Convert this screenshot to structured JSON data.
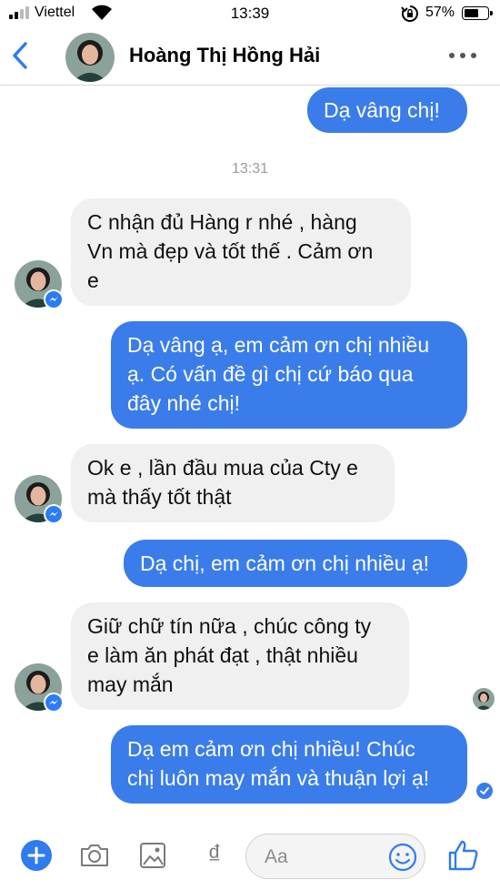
{
  "status_bar": {
    "carrier": "Viettel",
    "time": "13:39",
    "battery_percent": "57%"
  },
  "header": {
    "contact_name": "Hoàng Thị Hồng Hải"
  },
  "conversation": {
    "top_message": "Dạ vâng chị!",
    "timestamp": "13:31",
    "messages": [
      {
        "from": "contact",
        "line1": "C nhận đủ Hàng r nhé , hàng",
        "line2": "Vn mà đẹp và tốt thế . Cảm ơn",
        "line3": "e"
      },
      {
        "from": "me",
        "line1": "Dạ vâng ạ, em cảm ơn chị nhiều",
        "line2": "ạ. Có vấn đề gì chị cứ báo qua",
        "line3": "đây nhé chị!"
      },
      {
        "from": "contact",
        "line1": "Ok e , lần đầu mua của Cty e",
        "line2": "mà thấy tốt thật"
      },
      {
        "from": "me",
        "line1": "Dạ chị, em cảm ơn chị nhiều ạ!"
      },
      {
        "from": "contact",
        "line1": "Giữ chữ tín nữa , chúc công ty",
        "line2": "e làm ăn phát đạt , thật nhiều",
        "line3": "may mắn"
      },
      {
        "from": "me",
        "line1": "Dạ em cảm ơn chị nhiều! Chúc",
        "line2": "chị luôn may mắn và thuận lợi ạ!"
      }
    ]
  },
  "composer": {
    "placeholder": "Aa",
    "dong_symbol": "₫"
  },
  "colors": {
    "accent": "#3a7dea",
    "incoming_bubble": "#f0f0f1",
    "messenger_badge": "#2b7cf6"
  },
  "icons": [
    "signal-icon",
    "wifi-icon",
    "rotation-lock-icon",
    "battery-icon",
    "back-chevron-icon",
    "more-dots-icon",
    "messenger-badge-icon",
    "plus-icon",
    "camera-icon",
    "image-icon",
    "dong-icon",
    "emoji-icon",
    "thumbs-up-icon",
    "delivered-check-icon"
  ]
}
